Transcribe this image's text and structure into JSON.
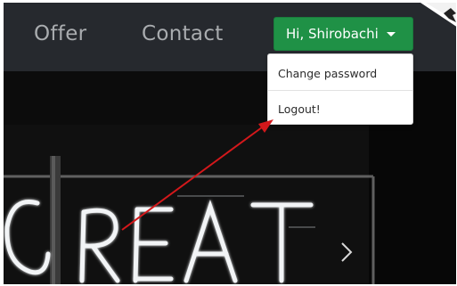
{
  "navbar": {
    "links": [
      {
        "label": "Offer"
      },
      {
        "label": "Contact"
      }
    ],
    "user_menu": {
      "greeting": "Hi, Shirobachi",
      "items": [
        {
          "label": "Change password"
        },
        {
          "label": "Logout!"
        }
      ]
    }
  },
  "hero": {
    "sign_text": "GREAT",
    "next_icon": "chevron-right-icon"
  },
  "annotation": {
    "arrow_color": "#d4181b"
  },
  "colors": {
    "navbar_bg": "#26292e",
    "button_green": "#1f9146",
    "nav_link": "#a9acaf"
  }
}
